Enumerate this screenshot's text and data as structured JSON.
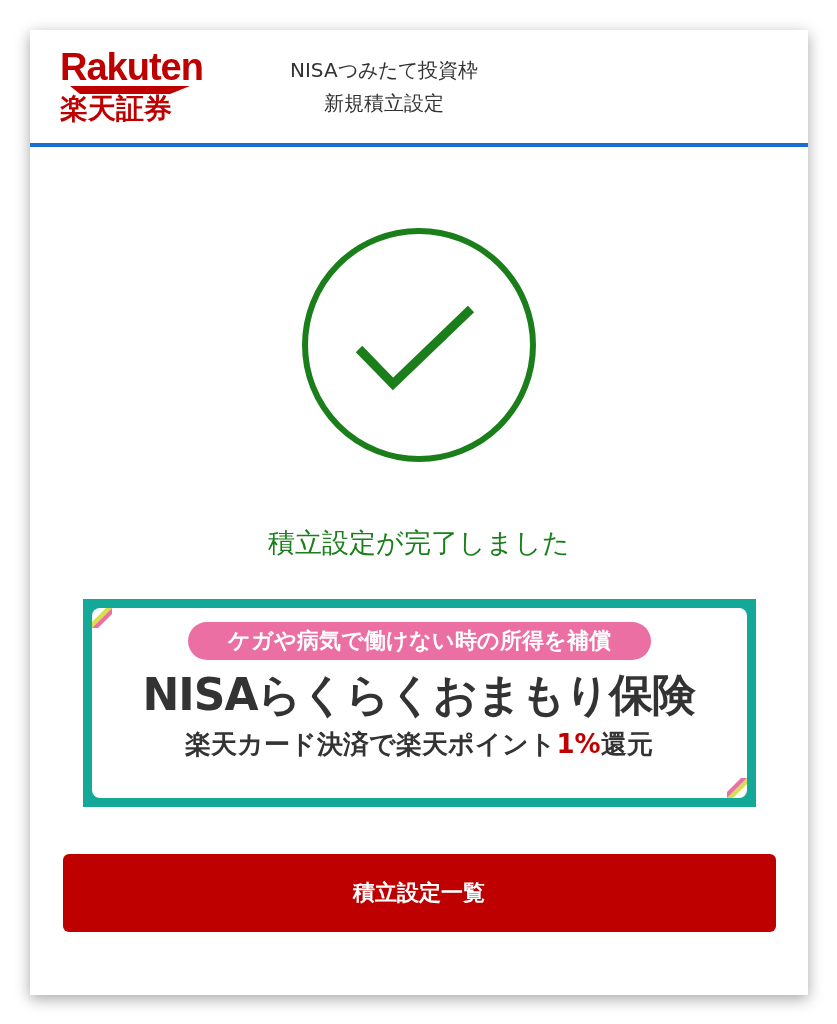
{
  "header": {
    "logo_word": "Rakuten",
    "logo_name": "楽天証券",
    "title_lines": [
      "NISAつみたて投資枠",
      "新規積立設定"
    ]
  },
  "result": {
    "completed": true,
    "message": "積立設定が完了しました"
  },
  "banner": {
    "tagline": "ケガや病気で働けない時の所得を補償",
    "headline": "NISAらくらくおまもり保険",
    "offer": {
      "before": "楽天カード決済で楽天ポイント",
      "highlight": "1%",
      "after": "還元"
    }
  },
  "button": {
    "label": "積立設定一覧"
  }
}
